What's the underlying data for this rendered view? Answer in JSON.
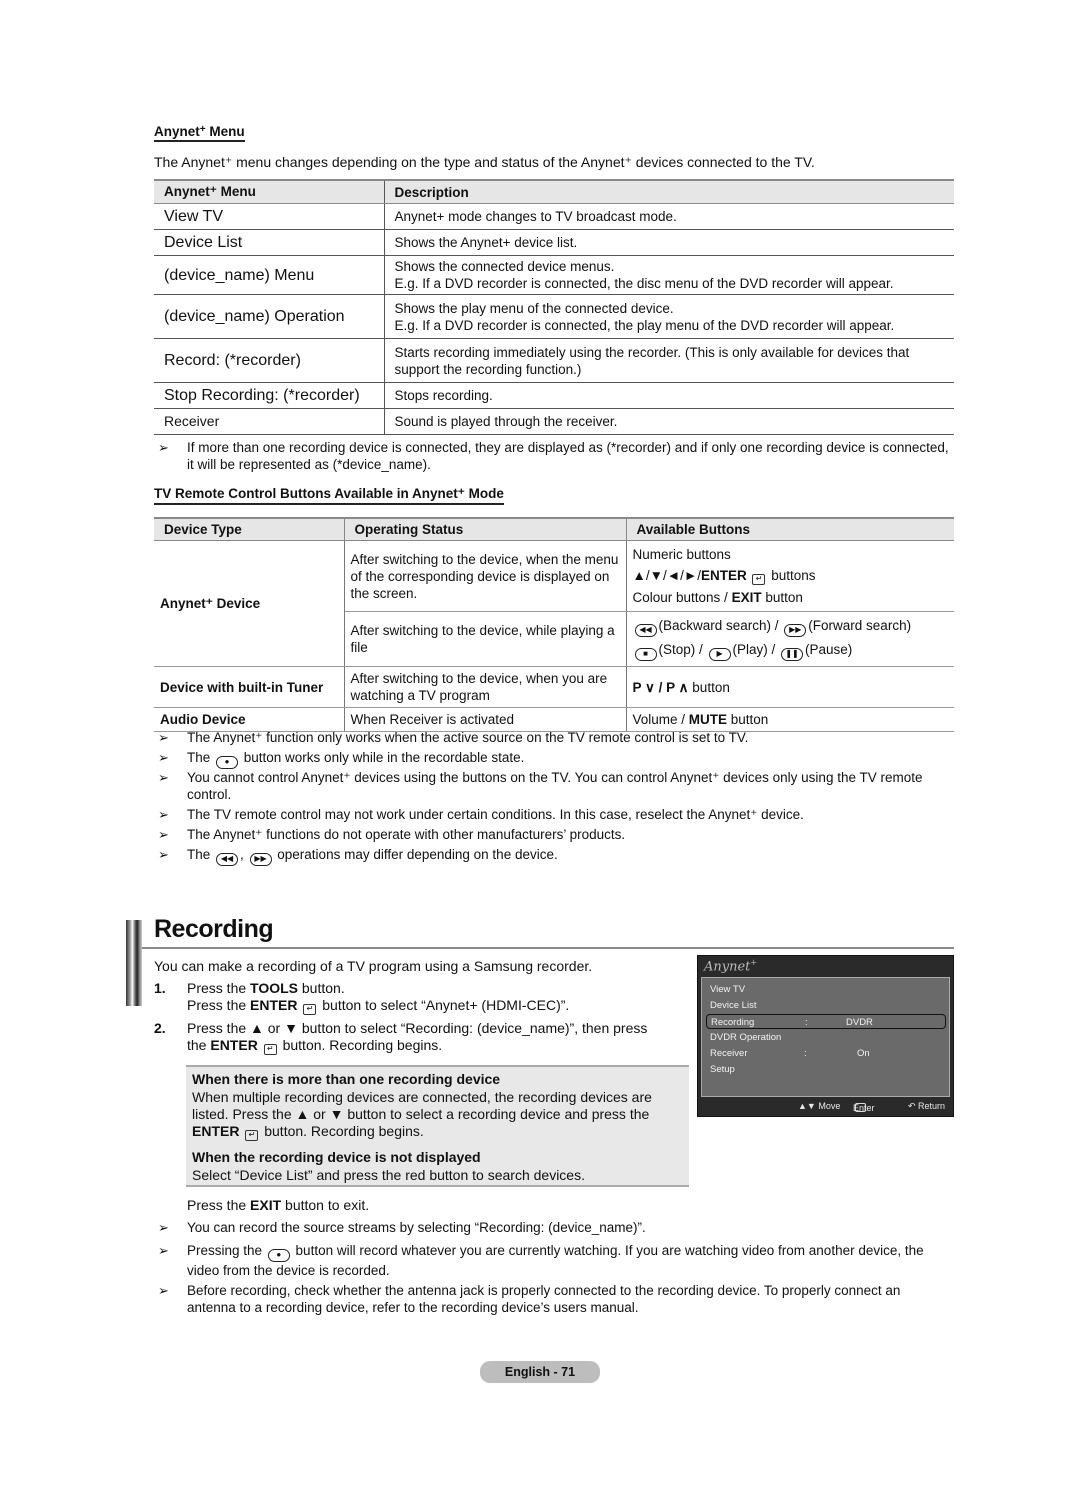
{
  "anynet_menu_section": {
    "heading": "Anynet",
    "heading_suffix": " Menu",
    "intro": "The Anynet⁺ menu changes depending on the type and status of the Anynet⁺ devices connected to the TV.",
    "table": {
      "headers": [
        "Anynet⁺ Menu",
        "Description"
      ],
      "rows": [
        {
          "menu": "View TV",
          "description": "Anynet+ mode changes to TV broadcast mode."
        },
        {
          "menu": "Device List",
          "description": "Shows the Anynet+ device list."
        },
        {
          "menu": "(device_name) Menu",
          "description": "Shows the connected device menus.",
          "description2": "E.g. If a DVD recorder is connected, the disc menu of the DVD recorder will appear."
        },
        {
          "menu": "(device_name) Operation",
          "description": "Shows the play menu of the connected device.",
          "description2": "E.g. If a DVD recorder is connected, the play menu of the DVD recorder will appear."
        },
        {
          "menu": "Record: (*recorder)",
          "description": "Starts recording immediately using the recorder. (This is only available for devices that",
          "description2": "support the recording function.)"
        },
        {
          "menu": "Stop Recording: (*recorder)",
          "description": "Stops recording."
        },
        {
          "menu": "Receiver",
          "description": "Sound is played through the receiver."
        }
      ]
    },
    "note": "If more than one recording device is connected, they are displayed as (*recorder) and if only one recording device is connected, it will be represented as (*device_name)."
  },
  "remote_section": {
    "heading": "TV Remote Control Buttons Available in Anynet⁺ Mode",
    "table": {
      "headers": [
        "Device Type",
        "Operating Status",
        "Available Buttons"
      ],
      "anynet_device": {
        "type": "Anynet⁺ Device",
        "status1": "After switching to the device, when the menu of the corresponding device is displayed on the screen.",
        "buttons1": [
          "Numeric buttons",
          "▲/▼/◄/►/",
          "ENTER",
          " buttons",
          "Colour buttons / ",
          "EXIT",
          " button"
        ],
        "status2": "After switching to the device, while playing a file",
        "buttons2a": [
          "(Backward search) / ",
          "(Forward search)"
        ],
        "buttons2b": [
          "(Stop) / ",
          "(Play) / ",
          "(Pause)"
        ]
      },
      "tuner_device": {
        "type": "Device with built-in Tuner",
        "status": "After switching to the device, when you are watching a TV program",
        "buttons_bold": "P ∨ / P ∧",
        "buttons_rest": " button"
      },
      "audio_device": {
        "type": "Audio Device",
        "status": "When Receiver is activated",
        "buttons_pre": "Volume / ",
        "buttons_bold": "MUTE",
        "buttons_post": " button"
      }
    },
    "notes": [
      "The Anynet⁺ function only works when the active source on the TV remote control is set to TV.",
      [
        "The ",
        " button works only while in the recordable state."
      ],
      "You cannot control Anynet⁺ devices using the buttons on the TV. You can control Anynet⁺ devices only using the TV remote control.",
      "The TV remote control may not work under certain conditions. In this case, reselect the Anynet⁺ device.",
      "The Anynet⁺ functions do not operate with other manufacturers’ products.",
      [
        "The ",
        ", ",
        " operations may differ depending on the device."
      ]
    ]
  },
  "recording_section": {
    "title": "Recording",
    "intro": "You can make a recording of a TV program using a Samsung recorder.",
    "steps": [
      {
        "num": "1.",
        "line1_pre": "Press the ",
        "line1_bold": "TOOLS",
        "line1_post": " button.",
        "line2_pre": "Press the ",
        "line2_bold": "ENTER",
        "line2_post": " button to select “Anynet+ (HDMI-CEC)”."
      },
      {
        "num": "2.",
        "line1": "Press the ▲ or ▼ button to select “Recording: (device_name)”, then press",
        "line2_pre": "the ",
        "line2_bold": "ENTER",
        "line2_post": " button. Recording begins."
      }
    ],
    "box": {
      "h1": "When there is more than one recording device",
      "p1": "When multiple recording devices are connected, the recording devices are listed. Press the ▲ or ▼ button to select a recording device and press the",
      "p1_bold": "ENTER",
      "p1_post": " button. Recording begins.",
      "h2": "When the recording device is not displayed",
      "p2": "Select “Device List” and press the red button to search devices."
    },
    "exit_pre": "Press the ",
    "exit_bold": "EXIT",
    "exit_post": " button to exit.",
    "notes": [
      "You can record the source streams by selecting “Recording: (device_name)”.",
      [
        "Pressing the ",
        " button will record whatever you are currently watching. If you are watching video from another device, the video from the device is recorded."
      ],
      "Before recording, check whether the antenna jack is properly connected to the recording device. To properly connect an antenna to a recording device, refer to the recording device’s users manual."
    ]
  },
  "osd": {
    "logo": "Anynet",
    "logo_sup": "+",
    "items": [
      {
        "label": "View TV"
      },
      {
        "label": "Device List"
      },
      {
        "label": "Recording",
        "colon": ":",
        "value": "DVDR",
        "selected": true
      },
      {
        "label": "DVDR Operation"
      },
      {
        "label": "Receiver",
        "colon": ":",
        "value": "On"
      },
      {
        "label": "Setup"
      }
    ],
    "footer": {
      "move": "▲▼ Move",
      "enter": "Enter",
      "return": "↶ Return"
    }
  },
  "footer": {
    "page": "English - 71"
  }
}
